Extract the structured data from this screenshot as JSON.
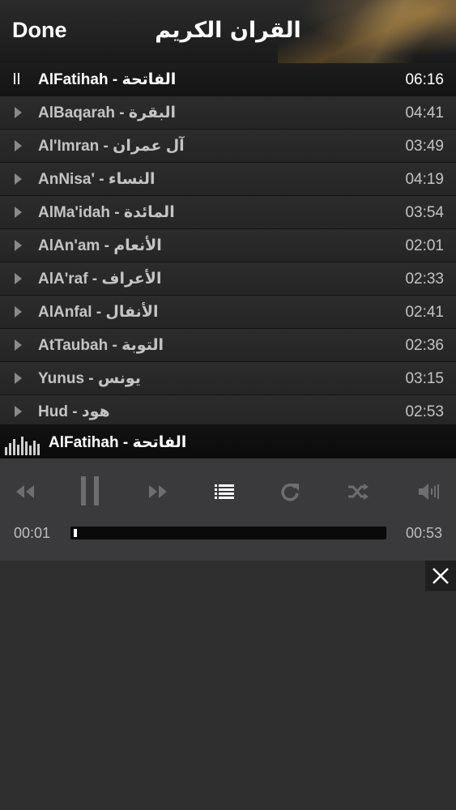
{
  "header": {
    "done_label": "Done",
    "title": "القران الكريم"
  },
  "tracks": [
    {
      "name": "AlFatihah - الفاتحة",
      "duration": "06:16",
      "playing": true
    },
    {
      "name": "AlBaqarah - البقرة",
      "duration": "04:41"
    },
    {
      "name": "Al'Imran - آل عمران",
      "duration": "03:49"
    },
    {
      "name": "AnNisa' - النساء",
      "duration": "04:19"
    },
    {
      "name": "AlMa'idah - المائدة",
      "duration": "03:54"
    },
    {
      "name": "AlAn'am - الأنعام",
      "duration": "02:01"
    },
    {
      "name": "AlA'raf - الأعراف",
      "duration": "02:33"
    },
    {
      "name": "AlAnfal - الأنفال",
      "duration": "02:41"
    },
    {
      "name": "AtTaubah - التوبة",
      "duration": "02:36"
    },
    {
      "name": "Yunus - يونس",
      "duration": "03:15"
    },
    {
      "name": "Hud - هود",
      "duration": "02:53"
    }
  ],
  "now_playing": {
    "title": "AlFatihah - الفاتحة",
    "elapsed": "00:01",
    "total": "00:53",
    "progress_fraction": 0.01
  },
  "icons": {
    "rewind": "rewind-icon",
    "pause": "pause-icon",
    "forward": "fast-forward-icon",
    "playlist": "playlist-icon",
    "repeat": "repeat-icon",
    "shuffle": "shuffle-icon",
    "volume": "volume-icon",
    "close": "close-icon"
  },
  "colors": {
    "accent": "#ffffff",
    "inactive_icon": "#6e6e6e",
    "background": "#2f2f30"
  }
}
